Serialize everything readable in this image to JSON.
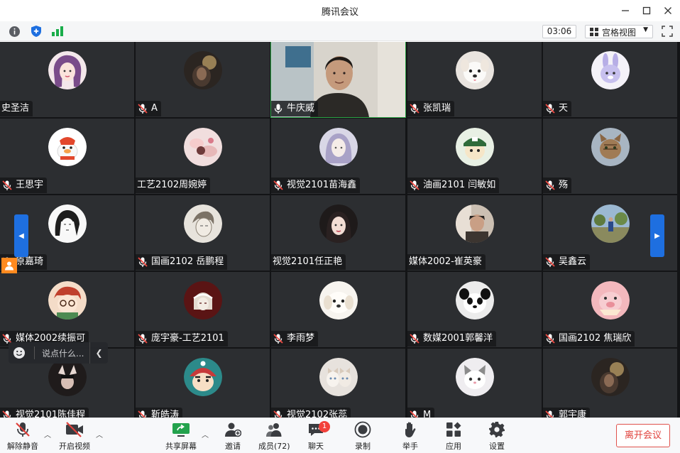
{
  "window": {
    "title": "腾讯会议"
  },
  "infobar": {
    "timer": "03:06",
    "view_mode": "宫格视图"
  },
  "colors": {
    "accent": "#1e6fe0",
    "active_speaker": "#2ba245",
    "danger": "#e0413b",
    "tile_bg": "#2c2e31"
  },
  "participants": [
    {
      "name": "史圣洁",
      "muted": false,
      "show_mic": false,
      "avatar": "avatar-girl-purple-hair"
    },
    {
      "name": "A",
      "muted": true,
      "show_mic": true,
      "avatar": "avatar-dark-photo"
    },
    {
      "name": "牛庆威",
      "muted": false,
      "show_mic": true,
      "avatar": "live-video"
    },
    {
      "name": "张凯瑞",
      "muted": true,
      "show_mic": true,
      "avatar": "avatar-white-dog"
    },
    {
      "name": "天",
      "muted": true,
      "show_mic": true,
      "avatar": "avatar-bunny"
    },
    {
      "name": "王思宇",
      "muted": true,
      "show_mic": true,
      "avatar": "avatar-duck-cartoon"
    },
    {
      "name": "工艺2102周婉婷",
      "muted": false,
      "show_mic": false,
      "avatar": "avatar-hands-photo"
    },
    {
      "name": "视觉2101苗海鑫",
      "muted": true,
      "show_mic": true,
      "avatar": "avatar-anime-girl"
    },
    {
      "name": "油画2101 闫敏如",
      "muted": true,
      "show_mic": true,
      "avatar": "avatar-cartoon-cap"
    },
    {
      "name": "殇",
      "muted": true,
      "show_mic": true,
      "avatar": "avatar-tabby-cat"
    },
    {
      "name": "原嘉琦",
      "muted": true,
      "show_mic": true,
      "avatar": "avatar-sketch-girl"
    },
    {
      "name": "国画2102 岳鹏程",
      "muted": true,
      "show_mic": true,
      "avatar": "avatar-sketch-boy"
    },
    {
      "name": "视觉2101任正艳",
      "muted": false,
      "show_mic": false,
      "avatar": "avatar-girl-photo"
    },
    {
      "name": "媒体2002-崔英豪",
      "muted": false,
      "show_mic": false,
      "avatar": "avatar-person-photo"
    },
    {
      "name": "吴鑫云",
      "muted": true,
      "show_mic": true,
      "avatar": "avatar-outdoor-photo"
    },
    {
      "name": "媒体2002续振可",
      "muted": true,
      "show_mic": true,
      "avatar": "avatar-cartoon-glasses"
    },
    {
      "name": "庞宇豪-工艺2101",
      "muted": true,
      "show_mic": true,
      "avatar": "avatar-red-sketch"
    },
    {
      "name": "李雨梦",
      "muted": true,
      "show_mic": true,
      "avatar": "avatar-fluffy-dog"
    },
    {
      "name": "数媒2001郭馨洋",
      "muted": true,
      "show_mic": true,
      "avatar": "avatar-panda-dog"
    },
    {
      "name": "国画2102 焦瑞欣",
      "muted": true,
      "show_mic": true,
      "avatar": "avatar-pink-pig"
    },
    {
      "name": "视觉2101陈佳程",
      "muted": true,
      "show_mic": true,
      "avatar": "avatar-dark-hands"
    },
    {
      "name": "靳皓涛",
      "muted": true,
      "show_mic": true,
      "avatar": "avatar-crayon-shin"
    },
    {
      "name": "视觉2102张蕊",
      "muted": true,
      "show_mic": true,
      "avatar": "avatar-two-cats"
    },
    {
      "name": "M",
      "muted": true,
      "show_mic": true,
      "avatar": "avatar-white-cat"
    },
    {
      "name": "郭宇康",
      "muted": true,
      "show_mic": true,
      "avatar": "avatar-dark-photo"
    }
  ],
  "chat_bubble": {
    "placeholder": "说点什么..."
  },
  "toolbar": {
    "unmute": "解除静音",
    "start_video": "开启视频",
    "share_screen": "共享屏幕",
    "invite": "邀请",
    "members": "成员(72)",
    "chat": "聊天",
    "chat_badge": "1",
    "record": "录制",
    "raise_hand": "举手",
    "apps": "应用",
    "settings": "设置",
    "leave": "离开会议"
  }
}
